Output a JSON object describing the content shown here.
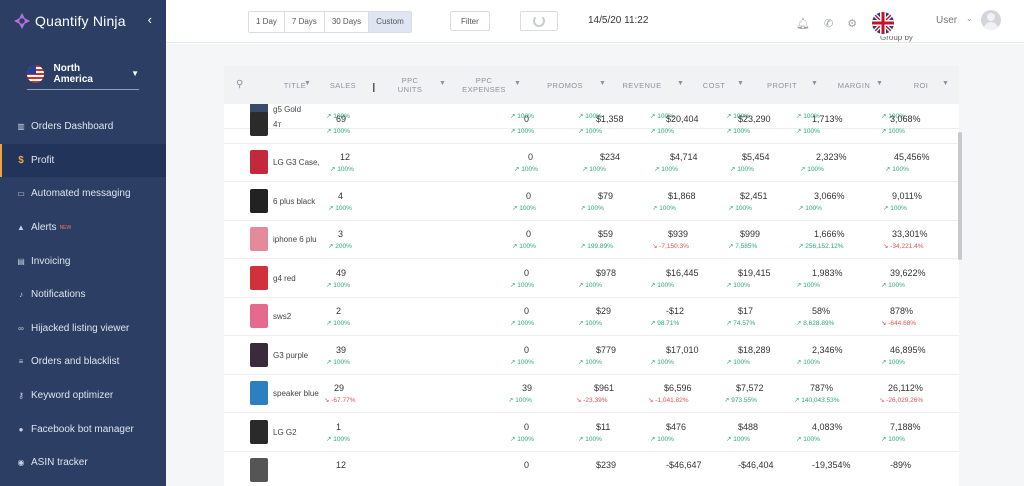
{
  "app": {
    "name": "Quantify Ninja",
    "collapse_icon": "chevron-left-icon"
  },
  "region": {
    "label": "North America",
    "flag": "us-flag-icon"
  },
  "sidebar": {
    "items": [
      {
        "label": "Orders Dashboard",
        "icon": "bars-icon"
      },
      {
        "label": "Profit",
        "icon": "dollar-icon",
        "active": true
      },
      {
        "label": "Automated messaging",
        "icon": "message-icon"
      },
      {
        "label": "Alerts",
        "icon": "alert-icon",
        "badge": "NEW"
      },
      {
        "label": "Invoicing",
        "icon": "invoice-icon"
      },
      {
        "label": "Notifications",
        "icon": "bell-icon"
      },
      {
        "label": "Hijacked listing viewer",
        "icon": "glasses-icon"
      },
      {
        "label": "Orders and blacklist",
        "icon": "list-icon"
      },
      {
        "label": "Keyword optimizer",
        "icon": "key-icon"
      },
      {
        "label": "Facebook bot manager",
        "icon": "chat-icon"
      },
      {
        "label": "ASIN tracker",
        "icon": "tracker-icon"
      }
    ]
  },
  "topbar": {
    "ranges": [
      {
        "label": "1 Day"
      },
      {
        "label": "7 Days"
      },
      {
        "label": "30 Days"
      },
      {
        "label": "Custom",
        "active": true
      }
    ],
    "filter_label": "Filter",
    "datetime": "14/5/20 11:22",
    "user_label": "User"
  },
  "groupby_label": "Group by",
  "table": {
    "columns": [
      {
        "label": "TITLE"
      },
      {
        "label": "SALES"
      },
      {
        "label": "PPC UNITS"
      },
      {
        "label": "PPC EXPENSES"
      },
      {
        "label": "PROMOS"
      },
      {
        "label": "REVENUE"
      },
      {
        "label": "COST"
      },
      {
        "label": "PROFIT"
      },
      {
        "label": "MARGIN"
      },
      {
        "label": "ROI"
      }
    ],
    "rows": [
      {
        "title": "g5 Gold",
        "thumb": "#3a4a6b",
        "sales": "",
        "sales_chg": "100%",
        "ppc_units": "",
        "ppc_exp": "",
        "promos": "",
        "promos_chg": "100%",
        "revenue": "",
        "revenue_chg": "100%",
        "cost": "",
        "cost_chg": "100%",
        "profit": "",
        "profit_chg": "100%",
        "margin": "",
        "margin_chg": "100%",
        "roi": "",
        "roi_chg": "100%",
        "partial": true
      },
      {
        "title": "4т",
        "thumb": "#2b2b2b",
        "sales": "69",
        "sales_chg": "100%",
        "ppc_units": "",
        "ppc_exp": "",
        "promos": "0",
        "promos_chg": "100%",
        "revenue": "$1,358",
        "revenue_chg": "100%",
        "cost": "$20,404",
        "cost_chg": "100%",
        "profit": "$23,290",
        "profit_chg": "100%",
        "margin": "1,713%",
        "margin_chg": "100%",
        "roi": "3,068%",
        "roi_chg": "100%"
      },
      {
        "title": "LG G3 Case,",
        "thumb": "#c4283c",
        "sales": "12",
        "sales_chg": "100%",
        "ppc_units": "",
        "ppc_exp": "",
        "promos": "0",
        "promos_chg": "100%",
        "revenue": "$234",
        "revenue_chg": "100%",
        "cost": "$4,714",
        "cost_chg": "100%",
        "profit": "$5,454",
        "profit_chg": "100%",
        "margin": "2,323%",
        "margin_chg": "100%",
        "roi": "45,456%",
        "roi_chg": "100%"
      },
      {
        "title": "6 plus black",
        "thumb": "#222222",
        "sales": "4",
        "sales_chg": "100%",
        "ppc_units": "",
        "ppc_exp": "",
        "promos": "0",
        "promos_chg": "100%",
        "revenue": "$79",
        "revenue_chg": "100%",
        "cost": "$1,868",
        "cost_chg": "100%",
        "profit": "$2,451",
        "profit_chg": "100%",
        "margin": "3,066%",
        "margin_chg": "100%",
        "roi": "9,011%",
        "roi_chg": "100%"
      },
      {
        "title": "iphone 6 plu",
        "thumb": "#e58a9a",
        "sales": "3",
        "sales_chg": "200%",
        "ppc_units": "",
        "ppc_exp": "",
        "promos": "0",
        "promos_chg": "100%",
        "revenue": "$59",
        "revenue_chg": "199.89%",
        "cost": "$939",
        "cost_chg": "-7,150.3%",
        "cost_down": true,
        "profit": "$999",
        "profit_chg": "7,585%",
        "margin": "1,666%",
        "margin_chg": "256,152.12%",
        "roi": "33,301%",
        "roi_chg": "-34,221.4%",
        "roi_down": true
      },
      {
        "title": "g4 red",
        "thumb": "#d0313a",
        "sales": "49",
        "sales_chg": "100%",
        "ppc_units": "",
        "ppc_exp": "",
        "promos": "0",
        "promos_chg": "100%",
        "revenue": "$978",
        "revenue_chg": "100%",
        "cost": "$16,445",
        "cost_chg": "100%",
        "profit": "$19,415",
        "profit_chg": "100%",
        "margin": "1,983%",
        "margin_chg": "100%",
        "roi": "39,622%",
        "roi_chg": "100%"
      },
      {
        "title": "sws2",
        "thumb": "#e46a8e",
        "sales": "2",
        "sales_chg": "100%",
        "ppc_units": "",
        "ppc_exp": "",
        "promos": "0",
        "promos_chg": "100%",
        "revenue": "$29",
        "revenue_chg": "100%",
        "cost": "-$12",
        "cost_chg": "98.71%",
        "profit": "$17",
        "profit_chg": "74.57%",
        "margin": "58%",
        "margin_chg": "8,628.89%",
        "roi": "878%",
        "roi_chg": "-644.68%",
        "roi_down": true
      },
      {
        "title": "G3 purple",
        "thumb": "#3b2a3a",
        "sales": "39",
        "sales_chg": "100%",
        "ppc_units": "",
        "ppc_exp": "",
        "promos": "0",
        "promos_chg": "100%",
        "revenue": "$779",
        "revenue_chg": "100%",
        "cost": "$17,010",
        "cost_chg": "100%",
        "profit": "$18,289",
        "profit_chg": "100%",
        "margin": "2,346%",
        "margin_chg": "100%",
        "roi": "46,895%",
        "roi_chg": "100%"
      },
      {
        "title": "speaker blue",
        "thumb": "#2d7fbf",
        "sales": "29",
        "sales_chg": "-67.77%",
        "sales_down": true,
        "ppc_units": "",
        "ppc_exp": "",
        "promos": "39",
        "promos_chg": "100%",
        "revenue": "$961",
        "revenue_chg": "-23.39%",
        "revenue_down": true,
        "cost": "$6,596",
        "cost_chg": "-1,041.82%",
        "cost_down": true,
        "profit": "$7,572",
        "profit_chg": "973.55%",
        "margin": "787%",
        "margin_chg": "140,043.53%",
        "roi": "26,112%",
        "roi_chg": "-26,029.26%",
        "roi_down": true
      },
      {
        "title": "LG G2",
        "thumb": "#2a2a2a",
        "sales": "1",
        "sales_chg": "100%",
        "ppc_units": "",
        "ppc_exp": "",
        "promos": "0",
        "promos_chg": "100%",
        "revenue": "$11",
        "revenue_chg": "100%",
        "cost": "$476",
        "cost_chg": "100%",
        "profit": "$488",
        "profit_chg": "100%",
        "margin": "4,083%",
        "margin_chg": "100%",
        "roi": "7,188%",
        "roi_chg": "100%"
      },
      {
        "title": "",
        "thumb": "#555555",
        "sales": "12",
        "sales_chg": "",
        "ppc_units": "",
        "ppc_exp": "",
        "promos": "0",
        "promos_chg": "",
        "revenue": "$239",
        "revenue_chg": "",
        "cost": "-$46,647",
        "cost_chg": "",
        "profit": "-$46,404",
        "profit_chg": "",
        "margin": "-19,354%",
        "margin_chg": "",
        "roi": "-89%",
        "roi_chg": "",
        "partial": true
      }
    ]
  }
}
